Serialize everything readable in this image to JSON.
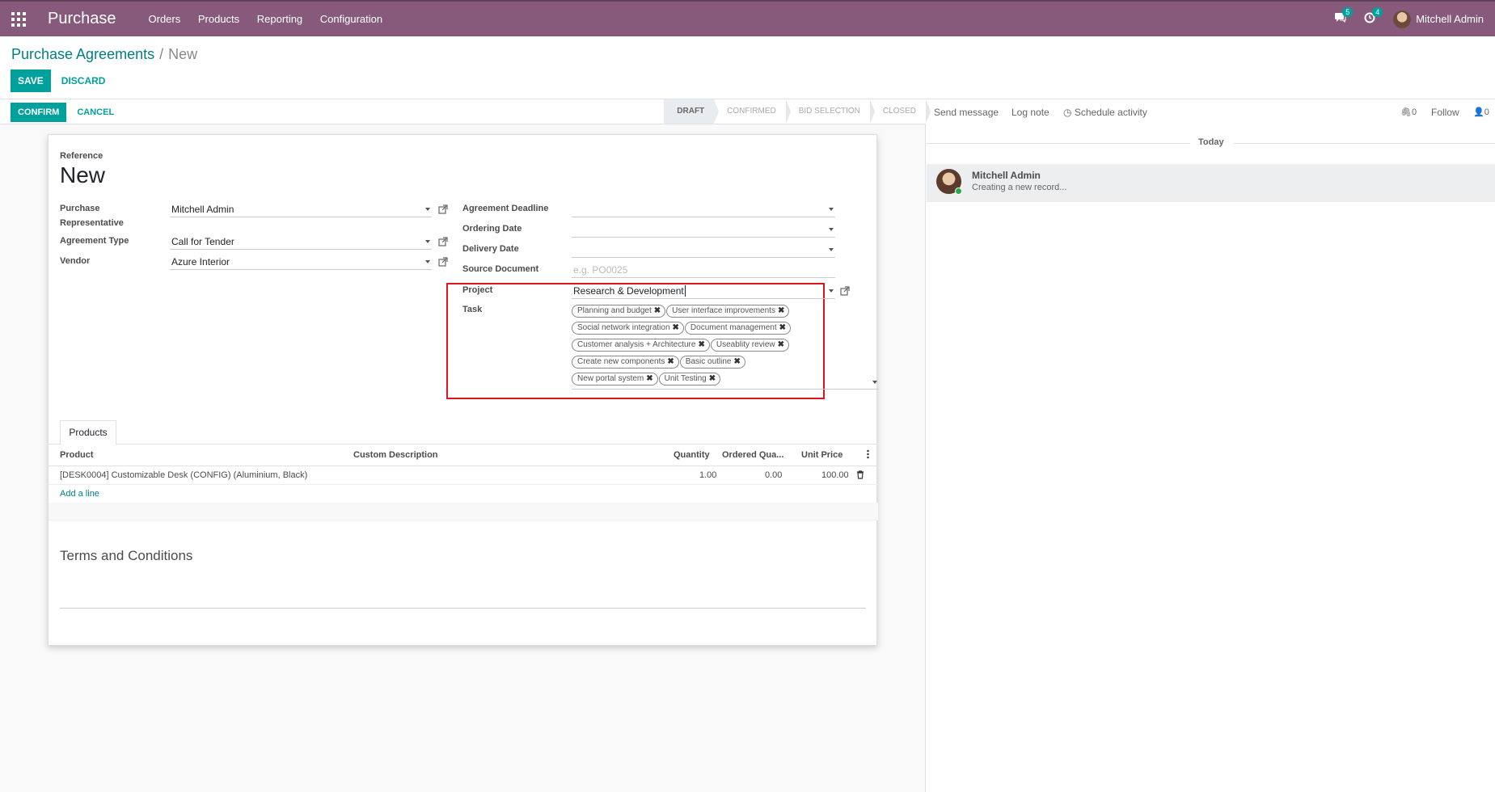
{
  "topbar": {
    "app_name": "Purchase",
    "menu": [
      "Orders",
      "Products",
      "Reporting",
      "Configuration"
    ],
    "messages_count": "5",
    "activities_count": "4",
    "user_name": "Mitchell Admin"
  },
  "breadcrumb": {
    "parent": "Purchase Agreements",
    "separator": "/",
    "current": "New"
  },
  "control": {
    "save": "SAVE",
    "discard": "DISCARD"
  },
  "statusbar": {
    "confirm": "CONFIRM",
    "cancel": "CANCEL",
    "stages": [
      "DRAFT",
      "CONFIRMED",
      "BID SELECTION",
      "CLOSED"
    ],
    "active_stage": "DRAFT"
  },
  "form": {
    "reference_label": "Reference",
    "reference_value": "New",
    "purchase_rep_label_1": "Purchase",
    "purchase_rep_label_2": "Representative",
    "purchase_rep_value": "Mitchell Admin",
    "agreement_type_label": "Agreement Type",
    "agreement_type_value": "Call for Tender",
    "vendor_label": "Vendor",
    "vendor_value": "Azure Interior",
    "deadline_label": "Agreement Deadline",
    "deadline_value": "",
    "ordering_date_label": "Ordering Date",
    "ordering_date_value": "",
    "delivery_date_label": "Delivery Date",
    "delivery_date_value": "",
    "source_doc_label": "Source Document",
    "source_doc_placeholder": "e.g. PO0025",
    "project_label": "Project",
    "project_value": "Research & Development",
    "task_label": "Task",
    "tasks": [
      "Planning and budget",
      "User interface improvements",
      "Social network integration",
      "Document management",
      "Customer analysis + Architecture",
      "Useablity review",
      "Create new components",
      "Basic outline",
      "New portal system",
      "Unit Testing"
    ]
  },
  "products": {
    "tab_label": "Products",
    "columns": {
      "product": "Product",
      "description": "Custom Description",
      "quantity": "Quantity",
      "ordered": "Ordered Qua...",
      "price": "Unit Price"
    },
    "rows": [
      {
        "product": "[DESK0004] Customizable Desk (CONFIG) (Aluminium, Black)",
        "description": "",
        "quantity": "1.00",
        "ordered": "0.00",
        "price": "100.00"
      }
    ],
    "add_line": "Add a line"
  },
  "terms_title": "Terms and Conditions",
  "chatter": {
    "send_message": "Send message",
    "log_note": "Log note",
    "schedule_activity": "Schedule activity",
    "attachments_count": "0",
    "follow": "Follow",
    "followers_count": "0",
    "today": "Today",
    "message": {
      "author": "Mitchell Admin",
      "body": "Creating a new record..."
    }
  },
  "colors": {
    "topbar": "#875a7b",
    "primary": "#00a09d",
    "link": "#017e84",
    "highlight": "#e0141e"
  }
}
